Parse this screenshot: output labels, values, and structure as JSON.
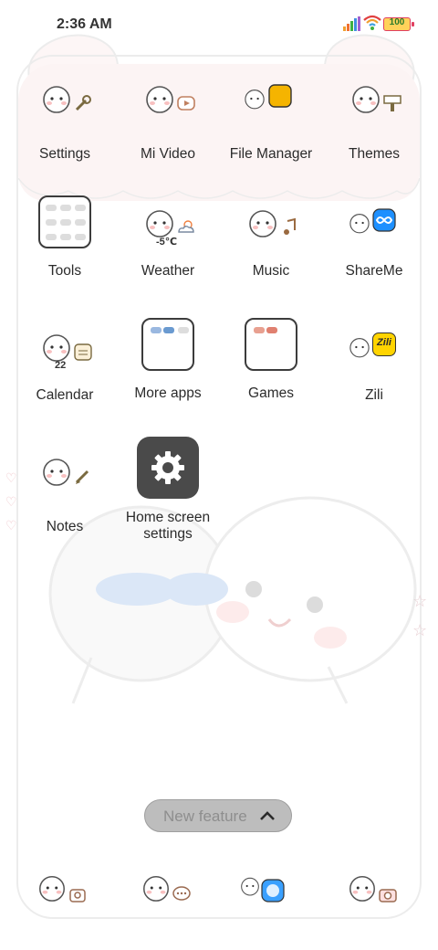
{
  "status": {
    "time": "2:36 AM",
    "battery": "100"
  },
  "apps": [
    {
      "label": "Settings"
    },
    {
      "label": "Mi Video"
    },
    {
      "label": "File Manager"
    },
    {
      "label": "Themes"
    },
    {
      "label": "Tools"
    },
    {
      "label": "Weather",
      "temp": "-5℃"
    },
    {
      "label": "Music"
    },
    {
      "label": "ShareMe"
    },
    {
      "label": "Calendar",
      "day": "22"
    },
    {
      "label": "More apps"
    },
    {
      "label": "Games"
    },
    {
      "label": "Zili",
      "badge": "Zili"
    },
    {
      "label": "Notes"
    },
    {
      "label": "Home screen settings"
    }
  ],
  "new_feature": {
    "label": "New feature"
  },
  "dock": [
    {
      "name": "phone"
    },
    {
      "name": "messages"
    },
    {
      "name": "browser"
    },
    {
      "name": "camera"
    }
  ],
  "colors": {
    "accent": "#4a4a4a",
    "panel": "#fcf4f4",
    "share_blue": "#1e90ff",
    "zili_yellow": "#ffd400",
    "file_orange": "#f5b400"
  }
}
